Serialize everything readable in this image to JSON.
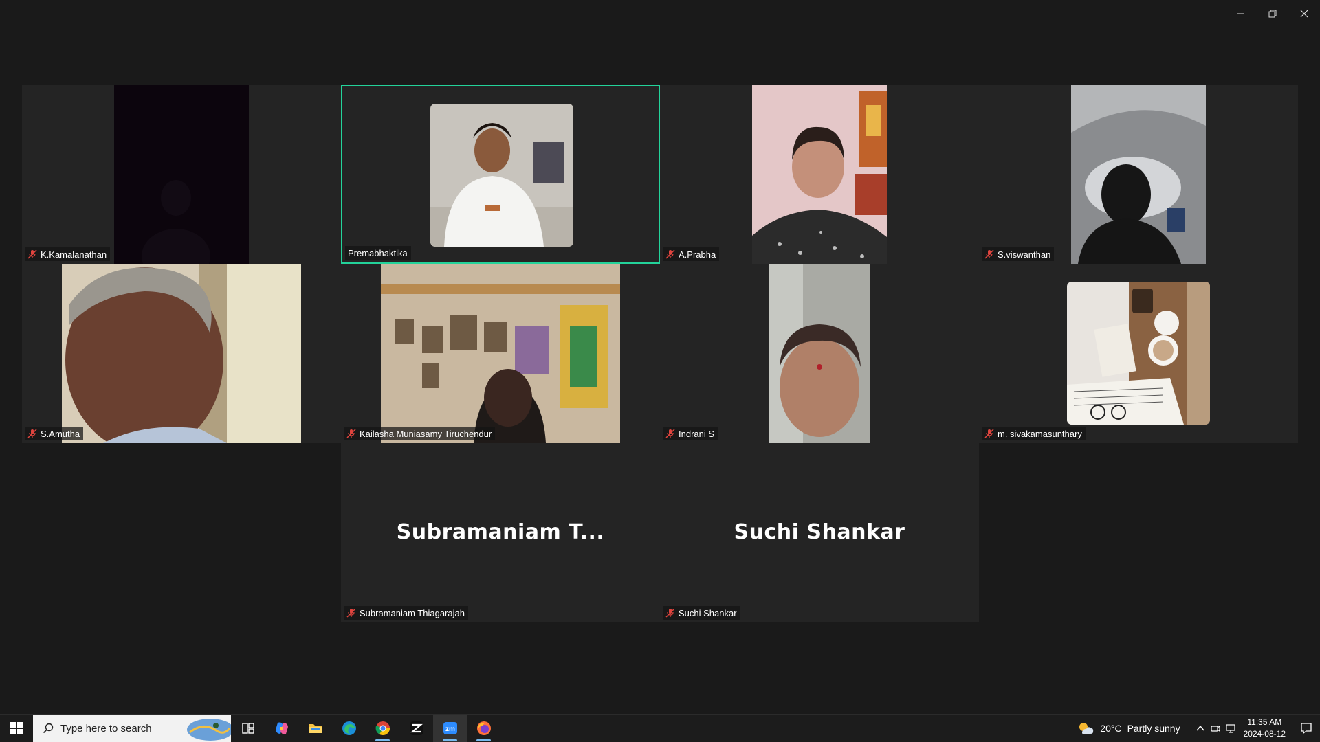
{
  "window": {
    "controls": [
      "minimize-icon",
      "restore-icon",
      "close-icon"
    ]
  },
  "gallery": {
    "active_speaker_color": "#23d39a",
    "muted_icon": "mic-muted-icon",
    "participants": [
      {
        "name": "K.Kamalanathan",
        "muted": true,
        "video": "dark-room"
      },
      {
        "name": "Premabhaktika",
        "muted": false,
        "active": true,
        "video": "woman-white-attire"
      },
      {
        "name": "A.Prabha",
        "muted": true,
        "video": "woman-pink-wall"
      },
      {
        "name": "S.viswanthan",
        "muted": true,
        "video": "backlit-silhouette"
      },
      {
        "name": "S.Amutha",
        "muted": true,
        "video": "woman-closeup"
      },
      {
        "name": "Kailasha Muniasamy Tiruchendur",
        "muted": true,
        "video": "man-shrine-shelf"
      },
      {
        "name": "Indrani S",
        "muted": true,
        "video": "elderly-woman"
      },
      {
        "name": "m. sivakamasunthary",
        "muted": true,
        "video": "coffee-book-still"
      },
      {
        "name": "Subramaniam Thiagarajah",
        "display": "Subramaniam  T...",
        "muted": true,
        "video": "none"
      },
      {
        "name": "Suchi Shankar",
        "display": "Suchi Shankar",
        "muted": true,
        "video": "none"
      }
    ]
  },
  "taskbar": {
    "search_placeholder": "Type here to search",
    "pinned": [
      "task-view-icon",
      "copilot-icon",
      "file-explorer-icon",
      "edge-icon",
      "chrome-icon",
      "capcut-icon",
      "zoom-icon",
      "firefox-icon"
    ],
    "weather": {
      "temp": "20°C",
      "condition": "Partly sunny"
    },
    "clock": {
      "time": "11:35 AM",
      "date": "2024-08-12"
    },
    "accent": "#76b9ed"
  }
}
